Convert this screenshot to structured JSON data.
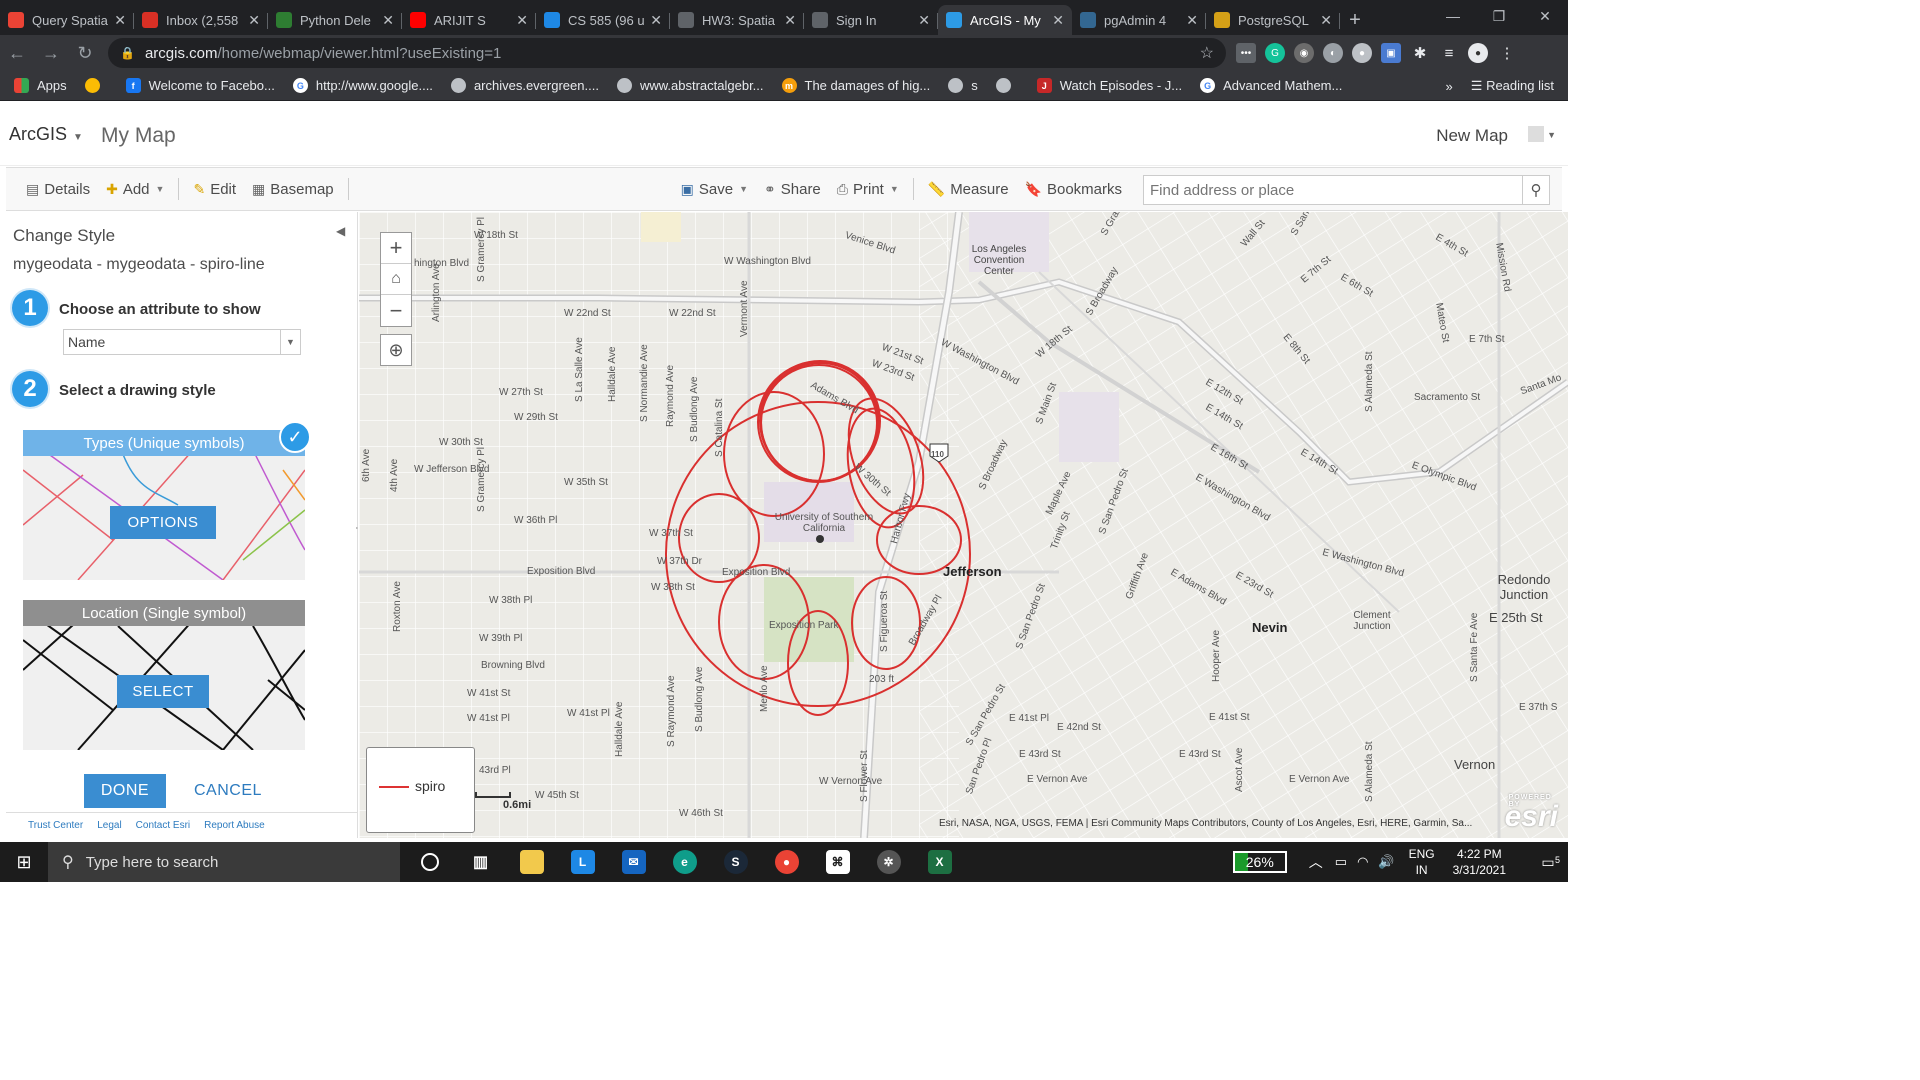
{
  "browser": {
    "tabs": [
      {
        "title": "Query Spatia",
        "color": "#ea4335"
      },
      {
        "title": "Inbox (2,558",
        "color": "#d93025"
      },
      {
        "title": "Python Dele",
        "color": "#2e7d32"
      },
      {
        "title": "ARIJIT S",
        "color": "#ff0000"
      },
      {
        "title": "CS 585 (96 u",
        "color": "#1e88e5"
      },
      {
        "title": "HW3: Spatia",
        "color": "#5f6368"
      },
      {
        "title": "Sign In",
        "color": "#5f6368"
      },
      {
        "title": "ArcGIS - My",
        "color": "#2d9be6"
      },
      {
        "title": "pgAdmin 4",
        "color": "#336791"
      },
      {
        "title": "PostgreSQL",
        "color": "#d4a017"
      }
    ],
    "url_host": "arcgis.com",
    "url_path": "/home/webmap/viewer.html?useExisting=1",
    "bookmarks": [
      "Apps",
      "",
      "Welcome to Facebo...",
      "http://www.google....",
      "archives.evergreen....",
      "www.abstractalgebr...",
      "The damages of hig...",
      "s",
      "",
      "Watch Episodes - J...",
      "Advanced Mathem..."
    ],
    "more_bookmarks": "»",
    "reading_list": "Reading list"
  },
  "header": {
    "brand": "ArcGIS",
    "map_title": "My Map",
    "new_map": "New Map"
  },
  "toolbar": {
    "details": "Details",
    "add": "Add",
    "edit": "Edit",
    "basemap": "Basemap",
    "save": "Save",
    "share": "Share",
    "print": "Print",
    "measure": "Measure",
    "bookmarks": "Bookmarks",
    "search_placeholder": "Find address or place"
  },
  "panel": {
    "title": "Change Style",
    "layer": "mygeodata - mygeodata - spiro-line",
    "step1_num": "1",
    "step1_label": "Choose an attribute to show",
    "attribute": "Name",
    "step2_num": "2",
    "step2_label": "Select a drawing style",
    "types_title": "Types (Unique symbols)",
    "options_btn": "OPTIONS",
    "location_title": "Location (Single symbol)",
    "select_btn": "SELECT",
    "done": "DONE",
    "cancel": "CANCEL",
    "footer": [
      "Trust Center",
      "Legal",
      "Contact Esri",
      "Report Abuse"
    ]
  },
  "map": {
    "labels": [
      "W 18th St",
      "W Washington Blvd",
      "hington Blvd",
      "W 22nd St",
      "W 22nd St",
      "Venice Blvd",
      "Los Angeles Convention Center",
      "W 21st St",
      "W 23rd St",
      "W Washington Blvd",
      "W 18th St",
      "S Broadway",
      "S Grand",
      "Wall St",
      "S San P",
      "E 7th St",
      "E 6th St",
      "E 8th St",
      "E 4th St",
      "Mission Rd",
      "Mateo St",
      "E 7th St",
      "E 12th St",
      "E 14th St",
      "Sacramento St",
      "Santa Mo",
      "W 27th St",
      "W 29th St",
      "S La Salle Ave",
      "Halldale Ave",
      "S Normandie Ave",
      "Raymond Ave",
      "S Budlong Ave",
      "Vermont Ave",
      "Adams Blvd",
      "W 30th St",
      "W 30th St",
      "W Jefferson Blvd",
      "W 35th St",
      "W 36th Pl",
      "W 37th St",
      "W 37th Dr",
      "W 38th St",
      "Exposition Blvd",
      "Exposition Blvd",
      "University of Southern California",
      "Harbor Fwy",
      "Jefferson",
      "E 16th St",
      "E 14th St",
      "E Olympic Blvd",
      "E Washington Blvd",
      "E Washington Blvd",
      "S Main St",
      "S Broadway",
      "Maple Ave",
      "Trinity St",
      "S San Pedro St",
      "Griffith Ave",
      "E Adams Blvd",
      "E 23rd St",
      "S Alameda St",
      "Redondo Junction",
      "E 25th St",
      "Clement Junction",
      "Nevin",
      "W 38th Pl",
      "W 39th Pl",
      "Browning Blvd",
      "W 41st St",
      "W 41st Pl",
      "W 41st Pl",
      "Exposition Park",
      "203 ft",
      "Broadway Pl",
      "S Figueroa St",
      "E 41st Pl",
      "E 42nd St",
      "E 41st St",
      "E 43rd St",
      "E 43rd St",
      "E 37th S",
      "S Santa Fe Ave",
      "Hooper Ave",
      "S San Pedro St",
      "W Vernon Ave",
      "E Vernon Ave",
      "E Vernon Ave",
      "Vernon",
      "43rd Pl",
      "W 45th St",
      "W 46th St",
      "Menlo Ave",
      "S Flower St",
      "S Budlong Ave",
      "S Raymond Ave",
      "Halldale Ave",
      "Roxton Ave",
      "6th Ave",
      "4th Ave",
      "Arlington Ave",
      "S Gramercy Pl",
      "S Gramercy Pl",
      "S Catalina St",
      "Ascot Ave",
      "S Alameda St",
      "San Pedro Pl",
      "S San Pedro St",
      "110"
    ],
    "legend_label": "spiro",
    "scale": "0.6mi",
    "attribution": "Esri, NASA, NGA, USGS, FEMA | Esri Community Maps Contributors, County of Los Angeles, Esri, HERE, Garmin, Sa...",
    "esri_logo": "esri",
    "esri_powered": "POWERED BY",
    "zoom_in": "+",
    "zoom_out": "−",
    "spiro_color": "#d9302f"
  },
  "taskbar": {
    "search_placeholder": "Type here to search",
    "battery": "26%",
    "battery_level": 0.26,
    "lang1": "ENG",
    "lang2": "IN",
    "time": "4:22 PM",
    "date": "3/31/2021",
    "notif": "5"
  }
}
